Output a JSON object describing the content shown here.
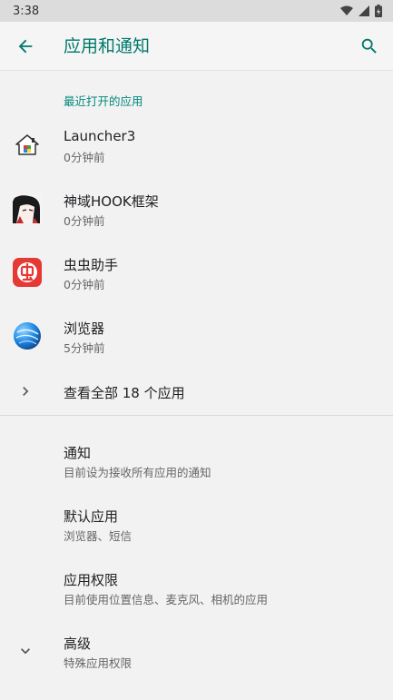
{
  "status_bar": {
    "time": "3:38"
  },
  "app_bar": {
    "title": "应用和通知"
  },
  "recent": {
    "header": "最近打开的应用",
    "apps": [
      {
        "name": "Launcher3",
        "time": "0分钟前",
        "icon": "launcher-icon"
      },
      {
        "name": "神域HOOK框架",
        "time": "0分钟前",
        "icon": "anime-avatar-icon"
      },
      {
        "name": "虫虫助手",
        "time": "0分钟前",
        "icon": "chongchong-icon"
      },
      {
        "name": "浏览器",
        "time": "5分钟前",
        "icon": "browser-globe-icon"
      }
    ],
    "see_all": "查看全部 18 个应用"
  },
  "settings": [
    {
      "title": "通知",
      "subtitle": "目前设为接收所有应用的通知"
    },
    {
      "title": "默认应用",
      "subtitle": "浏览器、短信"
    },
    {
      "title": "应用权限",
      "subtitle": "目前使用位置信息、麦克风、相机的应用"
    },
    {
      "title": "高级",
      "subtitle": "特殊应用权限"
    }
  ],
  "colors": {
    "accent": "#00796b",
    "header_accent": "#00897b",
    "background": "#f2f2f2"
  }
}
